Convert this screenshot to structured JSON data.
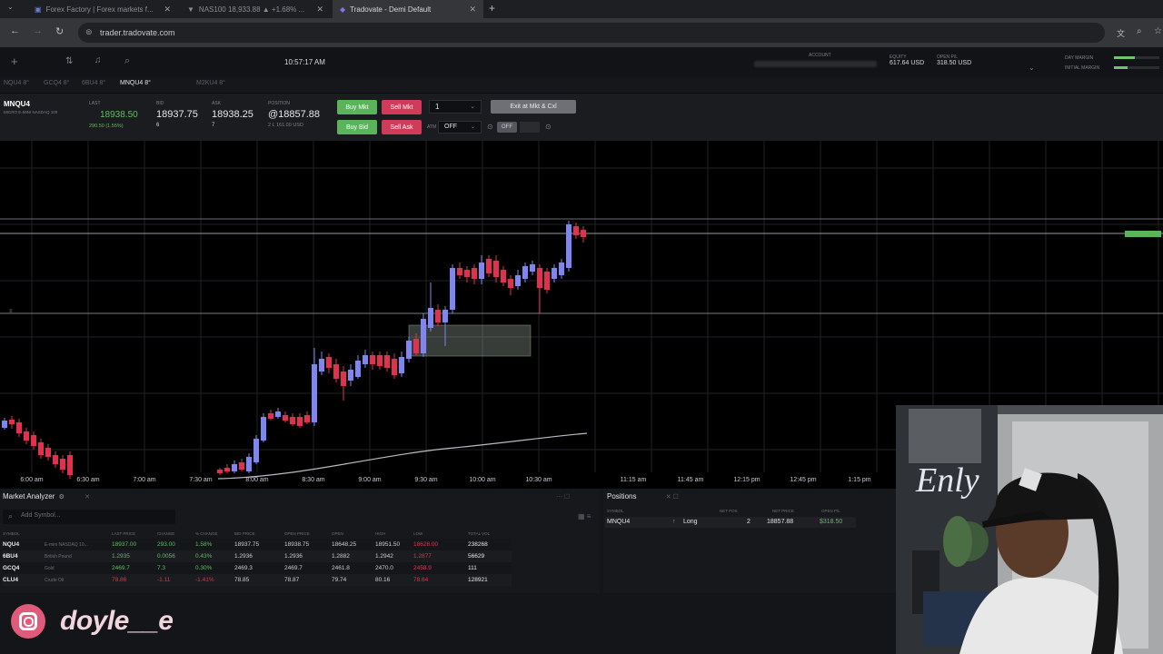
{
  "browser": {
    "tabs": [
      {
        "label": "Forex Factory | Forex markets f..."
      },
      {
        "label": "NAS100 18,933.88 ▲ +1.68% ..."
      },
      {
        "label": "Tradovate - Demi Default"
      }
    ],
    "url": "trader.tradovate.com"
  },
  "header": {
    "clock": "10:57:17 AM",
    "account_label": "ACCOUNT",
    "equity_label": "EQUITY",
    "equity_value": "617.64 USD",
    "open_pl_label": "OPEN P/L",
    "open_pl_value": "318.50 USD",
    "day_margin_label": "DAY MARGIN",
    "initial_margin_label": "INITIAL MARGIN"
  },
  "symbol_tabs": [
    "NQU4 8°",
    "GCQ4 8°",
    "6BU4 8°",
    "MNQU4 8°",
    "M2KU4 8°"
  ],
  "order_bar": {
    "symbol": "MNQU4",
    "symbol_desc": "MICRO E-MINI NASDAQ 100",
    "last_label": "LAST",
    "last_price": "18938.50",
    "last_change": "290.50 (1.55%)",
    "bid_label": "BID",
    "bid_price": "18937.75",
    "bid_size": "6",
    "ask_label": "ASK",
    "ask_price": "18938.25",
    "ask_size": "7",
    "position_label": "POSITION",
    "position_price": "@18857.88",
    "position_detail": "2 L 161.00 USD",
    "buy_mkt": "Buy Mkt",
    "sell_mkt": "Sell Mkt",
    "buy_bid": "Buy Bid",
    "sell_ask": "Sell Ask",
    "qty": "1",
    "exit_all": "Exit at Mkt & Cxl",
    "atm_label": "ATM",
    "atm_value": "OFF",
    "off_label": "OFF"
  },
  "chart_data": {
    "type": "candlestick",
    "x_ticks": [
      "6:00 am",
      "6:30 am",
      "7:00 am",
      "7:30 am",
      "8:00 am",
      "8:30 am",
      "9:00 am",
      "9:30 am",
      "10:00 am",
      "10:30 am",
      "11:15 am",
      "11:45 am",
      "12:15 pm",
      "12:45 pm",
      "1:15 pm"
    ],
    "colors": {
      "up": "#7f86f2",
      "down": "#e0324f",
      "grid": "#1f2226"
    }
  },
  "market_analyzer": {
    "title": "Market Analyzer",
    "search_placeholder": "Add Symbol...",
    "columns": [
      "SYMBOL",
      "",
      "LAST PRICE",
      "CHANGE",
      "% CHANGE",
      "BID PRICE",
      "OPEN PRICE",
      "OPEN",
      "HIGH",
      "LOW",
      "TOTAL VOL"
    ],
    "rows": [
      {
        "symbol": "NQU4",
        "desc": "E-mini NASDAQ 10...",
        "last": "18937.00",
        "chg": "293.00",
        "pct": "1.58%",
        "bid": "18937.75",
        "open": "18938.75",
        "o": "18648.25",
        "high": "18951.50",
        "low": "18628.00",
        "vol": "238268"
      },
      {
        "symbol": "6BU4",
        "desc": "British Pound",
        "last": "1.2935",
        "chg": "0.0056",
        "pct": "0.43%",
        "bid": "1.2936",
        "open": "1.2936",
        "o": "1.2882",
        "high": "1.2942",
        "low": "1.2877",
        "vol": "56629"
      },
      {
        "symbol": "GCQ4",
        "desc": "Gold",
        "last": "2469.7",
        "chg": "7.3",
        "pct": "0.30%",
        "bid": "2469.3",
        "open": "2469.7",
        "o": "2461.8",
        "high": "2470.0",
        "low": "2458.9",
        "vol": "111"
      },
      {
        "symbol": "CLU4",
        "desc": "Crude Oil",
        "last": "78.86",
        "chg": "-1.11",
        "pct": "-1.41%",
        "bid": "78.85",
        "open": "78.87",
        "o": "79.74",
        "high": "80.16",
        "low": "78.64",
        "vol": "128921"
      }
    ]
  },
  "positions": {
    "title": "Positions",
    "columns": [
      "SYMBOL",
      "",
      "NET POS",
      "NET PRICE",
      "OPEN P/L"
    ],
    "row": {
      "symbol": "MNQU4",
      "side": "Long",
      "net_pos": "2",
      "net_price": "18857.88",
      "open_pl": "$318.50"
    }
  },
  "watermark": "doyle__e"
}
